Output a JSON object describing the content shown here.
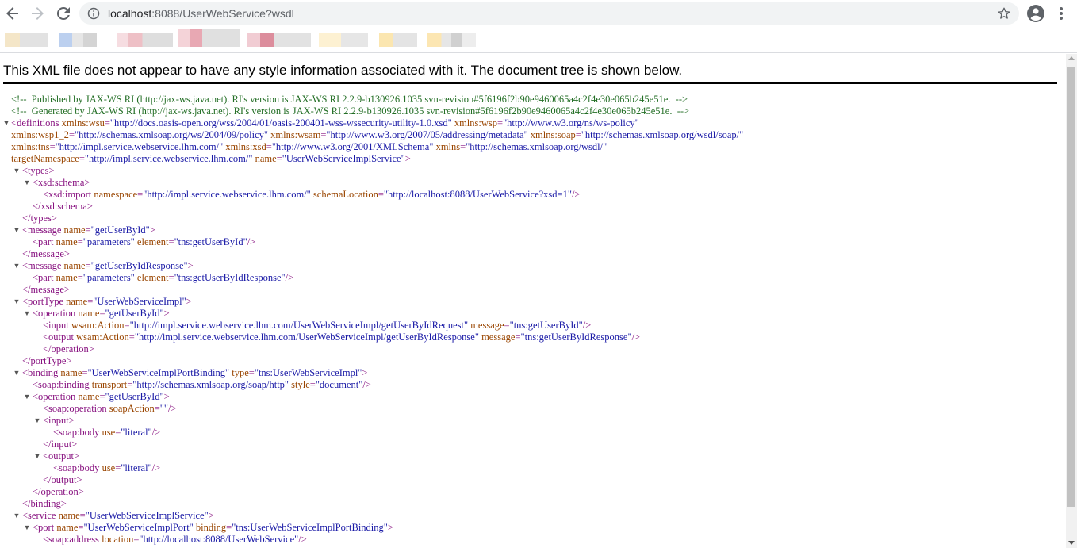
{
  "browser": {
    "url_host": "localhost",
    "url_rest": ":8088/UserWebService?wsdl"
  },
  "bookmarks": {
    "item_colors": [
      "#f4e6c8",
      "#d8d8d8",
      "#bcd0ef",
      "#d8d8d8",
      "#f1c9cf",
      "#d8d8d8",
      "#ebc0c8",
      "#d8d8d8",
      "#e6b3c0",
      "#d8d8d8",
      "#fdf0cc",
      "#fbe8b4",
      "#d8d8d8"
    ]
  },
  "page": {
    "notice": "This XML file does not appear to have any style information associated with it. The document tree is shown below."
  },
  "xml_tree": {
    "comment_published": "<!--  Published by JAX-WS RI (http://jax-ws.java.net). RI's version is JAX-WS RI 2.2.9-b130926.1035 svn-revision#5f6196f2b90e9460065a4c2f4e30e065b245e51e.  -->",
    "comment_generated": "<!--  Generated by JAX-WS RI (http://jax-ws.java.net). RI's version is JAX-WS RI 2.2.9-b130926.1035 svn-revision#5f6196f2b90e9460065a4c2f4e30e065b245e51e.  -->",
    "definitions": {
      "tag": "definitions",
      "xmlns_wsu_name": "xmlns:wsu",
      "xmlns_wsu_value": "\"http://docs.oasis-open.org/wss/2004/01/oasis-200401-wss-wssecurity-utility-1.0.xsd\"",
      "xmlns_wsp_name": "xmlns:wsp",
      "xmlns_wsp_value": "\"http://www.w3.org/ns/ws-policy\"",
      "xmlns_wsp12_name": "xmlns:wsp1_2",
      "xmlns_wsp12_value": "\"http://schemas.xmlsoap.org/ws/2004/09/policy\"",
      "xmlns_wsam_name": "xmlns:wsam",
      "xmlns_wsam_value": "\"http://www.w3.org/2007/05/addressing/metadata\"",
      "xmlns_soap_name": "xmlns:soap",
      "xmlns_soap_value": "\"http://schemas.xmlsoap.org/wsdl/soap/\"",
      "xmlns_tns_name": "xmlns:tns",
      "xmlns_tns_value": "\"http://impl.service.webservice.lhm.com/\"",
      "xmlns_xsd_name": "xmlns:xsd",
      "xmlns_xsd_value": "\"http://www.w3.org/2001/XMLSchema\"",
      "xmlns_name": "xmlns",
      "xmlns_value": "\"http://schemas.xmlsoap.org/wsdl/\"",
      "targetns_name": "targetNamespace",
      "targetns_value": "\"http://impl.service.webservice.lhm.com/\"",
      "name_name": "name",
      "name_value": "\"UserWebServiceImplService\""
    },
    "types_open": "<types>",
    "schema_open": "<xsd:schema>",
    "import_tag": "<xsd:import",
    "import_ns_name": "namespace",
    "import_ns_value": "\"http://impl.service.webservice.lhm.com/\"",
    "import_loc_name": "schemaLocation",
    "import_loc_value": "\"http://localhost:8088/UserWebService?xsd=1\"",
    "self_close": "/>",
    "schema_close": "</xsd:schema>",
    "types_close": "</types>",
    "msg1_tag": "<message",
    "msg1_name_attr": "name",
    "msg1_name_value": "\"getUserById\"",
    "part_tag": "<part",
    "part_name_attr": "name",
    "part_name_value": "\"parameters\"",
    "part_element_attr": "element",
    "part1_element_value": "\"tns:getUserById\"",
    "message_close": "</message>",
    "msg2_name_value": "\"getUserByIdResponse\"",
    "part2_element_value": "\"tns:getUserByIdResponse\"",
    "porttype_tag": "<portType",
    "porttype_name_value": "\"UserWebServiceImpl\"",
    "operation_tag": "<operation",
    "operation_name_value": "\"getUserById\"",
    "input_tag": "<input",
    "wsam_action_attr": "wsam:Action",
    "input_action_value": "\"http://impl.service.webservice.lhm.com/UserWebServiceImpl/getUserByIdRequest\"",
    "message_attr": "message",
    "input_message_value": "\"tns:getUserById\"",
    "output_tag": "<output",
    "output_action_value": "\"http://impl.service.webservice.lhm.com/UserWebServiceImpl/getUserByIdResponse\"",
    "output_message_value": "\"tns:getUserByIdResponse\"",
    "operation_close": "</operation>",
    "porttype_close": "</portType>",
    "binding_tag": "<binding",
    "binding_name_value": "\"UserWebServiceImplPortBinding\"",
    "type_attr": "type",
    "binding_type_value": "\"tns:UserWebServiceImpl\"",
    "soap_binding_tag": "<soap:binding",
    "transport_attr": "transport",
    "transport_value": "\"http://schemas.xmlsoap.org/soap/http\"",
    "style_attr": "style",
    "style_value": "\"document\"",
    "soap_operation_tag": "<soap:operation",
    "soap_action_attr": "soapAction",
    "soap_action_value": "\"\"",
    "input_open": "<input>",
    "soap_body_tag": "<soap:body",
    "use_attr": "use",
    "use_value": "\"literal\"",
    "input_close": "</input>",
    "output_open": "<output>",
    "output_close": "</output>",
    "binding_close": "</binding>",
    "service_tag": "<service",
    "service_name_value": "\"UserWebServiceImplService\"",
    "port_tag": "<port",
    "port_name_value": "\"UserWebServiceImplPort\"",
    "binding_attr": "binding",
    "port_binding_value": "\"tns:UserWebServiceImplPortBinding\"",
    "soap_address_tag": "<soap:address",
    "location_attr": "location",
    "location_value": "\"http://localhost:8088/UserWebService\"",
    "gt": ">",
    "sp": " ",
    "eq": "=",
    "toggle": "▼"
  }
}
